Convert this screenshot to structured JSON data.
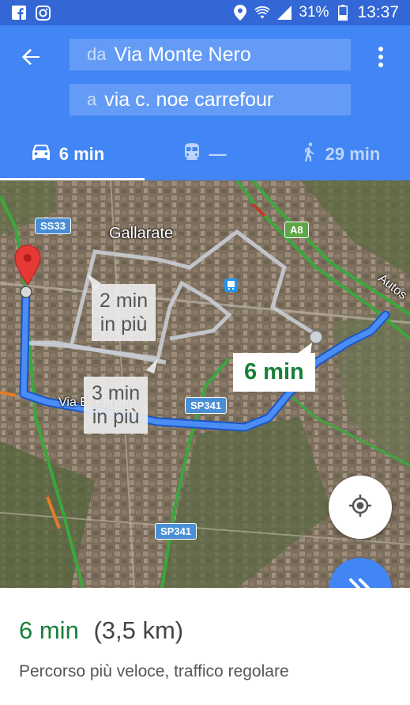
{
  "status_bar": {
    "battery": "31%",
    "time": "13:37"
  },
  "header": {
    "from_prefix": "da",
    "from_value": "Via Monte Nero",
    "to_prefix": "a",
    "to_value": "via c. noe carrefour"
  },
  "modes": [
    {
      "icon": "car-icon",
      "label": "6 min"
    },
    {
      "icon": "train-icon",
      "label": "—"
    },
    {
      "icon": "walk-icon",
      "label": "29 min"
    }
  ],
  "map": {
    "city_label": "Gallarate",
    "street_label": "Via E. Ferrari",
    "shields": [
      "SS33",
      "A8",
      "SP341",
      "SP341"
    ],
    "highway_text": "Autos",
    "alt_route_1": "2 min\nin più",
    "alt_route_2": "3 min\nin più",
    "main_route": "6 min"
  },
  "sheet": {
    "time": "6 min",
    "distance": "(3,5 km)",
    "description": "Percorso più veloce, traffico regolare"
  },
  "colors": {
    "header": "#4285f4",
    "status": "#3367d6",
    "route": "#4285f4",
    "eta_green": "#188038"
  }
}
